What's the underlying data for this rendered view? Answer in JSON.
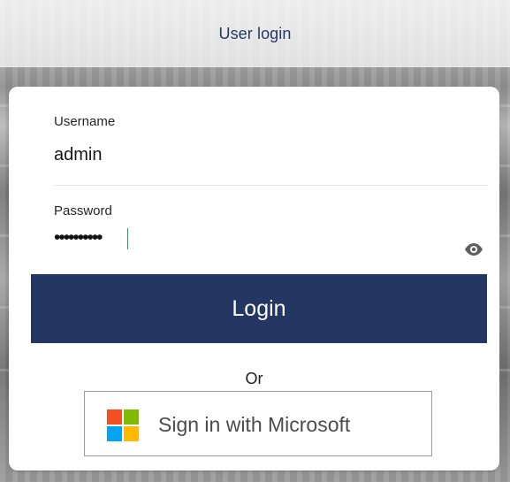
{
  "header": {
    "title": "User login"
  },
  "login_form": {
    "username_label": "Username",
    "username_value": "admin",
    "password_label": "Password",
    "password_masked": "••••••••••",
    "login_button_label": "Login",
    "divider_text": "Or",
    "microsoft_button_label": "Sign in with Microsoft"
  },
  "icons": {
    "password_visibility": "eye-icon",
    "microsoft_logo": "microsoft-logo-icon"
  },
  "colors": {
    "brand": "#243763",
    "background": "#8f8f8f",
    "surface": "#ffffff",
    "text": "#1e1e1e",
    "microsoft_red": "#f25022",
    "microsoft_green": "#7fba00",
    "microsoft_blue": "#00a4ef",
    "microsoft_yellow": "#ffb900",
    "caret": "#1c9f56"
  }
}
